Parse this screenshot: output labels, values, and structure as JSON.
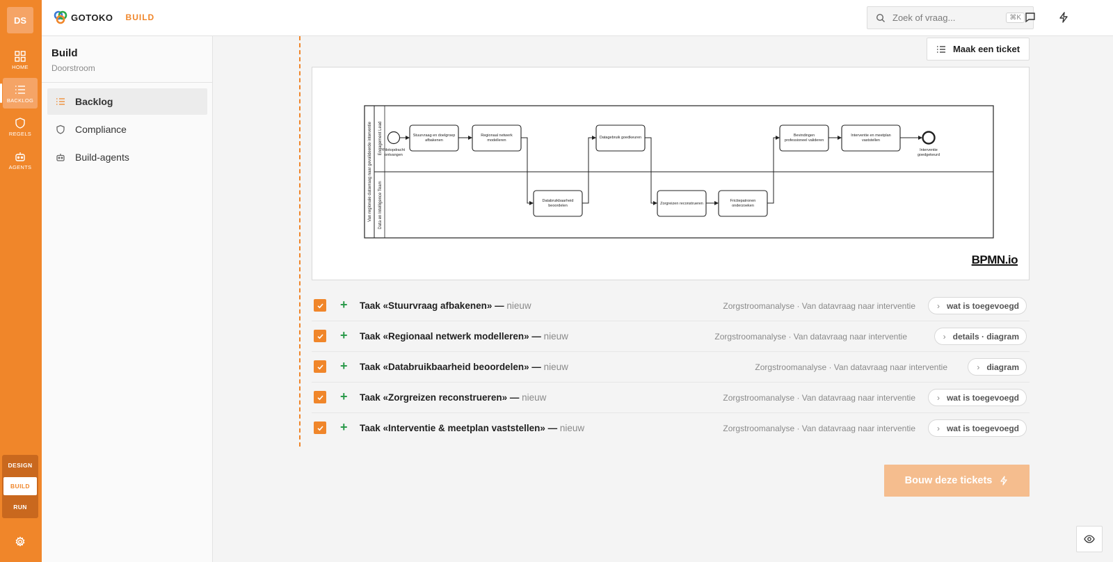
{
  "rail": {
    "avatar": "DS",
    "items": [
      {
        "label": "HOME",
        "icon": "grid-icon"
      },
      {
        "label": "BACKLOG",
        "icon": "list-icon"
      },
      {
        "label": "REGELS",
        "icon": "shield-icon"
      },
      {
        "label": "AGENTS",
        "icon": "robot-icon"
      }
    ],
    "modes": [
      "DESIGN",
      "BUILD",
      "RUN"
    ],
    "accent": "#f0862a"
  },
  "topbar": {
    "logo_text": "GOTOKO",
    "badge": "BUILD",
    "search_placeholder": "Zoek of vraag...",
    "search_shortcut": "⌘K"
  },
  "subnav": {
    "title": "Build",
    "subtitle": "Doorstroom",
    "items": [
      {
        "label": "Backlog",
        "icon": "list-icon",
        "active": true
      },
      {
        "label": "Compliance",
        "icon": "shield-icon",
        "active": false
      },
      {
        "label": "Build-agents",
        "icon": "robot-icon",
        "active": false
      }
    ]
  },
  "main": {
    "ticket_button": "Maak een ticket",
    "diagram": {
      "pool_label": "Van regionale datavraag naar gevalideerde interventie",
      "lanes": [
        "Engagement Lead",
        "Data en Intelligence Team"
      ],
      "start_event": "Pilotopdracht ontvangen",
      "end_event": "Interventie goedgekeurd",
      "tasks": {
        "t1": [
          "Stuurvraag en doelgroep",
          "afbakenen"
        ],
        "t2": [
          "Regionaal netwerk",
          "modelleren"
        ],
        "t3": [
          "Databruikbaarheid",
          "beoordelen"
        ],
        "t4": [
          "Datagebruik goedkeuren"
        ],
        "t5": [
          "Zorgreizen reconstrueren"
        ],
        "t6": [
          "Frictiepatronen",
          "onderzoeken"
        ],
        "t7": [
          "Bevindingen",
          "professioneel valideren"
        ],
        "t8": [
          "Interventie en meetplan",
          "vaststellen"
        ]
      },
      "brand": "BPMN.io"
    },
    "tickets": [
      {
        "title": "Taak «Stuurvraag afbakenen» —",
        "status": " nieuw",
        "context": "Zorgstroomanalyse · Van datavraag naar interventie",
        "action": "wat is toegevoegd"
      },
      {
        "title": "Taak «Regionaal netwerk modelleren» —",
        "status": " nieuw",
        "context": "Zorgstroomanalyse · Van datavraag naar interventie",
        "action": "details · diagram"
      },
      {
        "title": "Taak «Databruikbaarheid beoordelen» —",
        "status": " nieuw",
        "context": "Zorgstroomanalyse · Van datavraag naar interventie",
        "action": "diagram"
      },
      {
        "title": "Taak «Zorgreizen reconstrueren» —",
        "status": " nieuw",
        "context": "Zorgstroomanalyse · Van datavraag naar interventie",
        "action": "wat is toegevoegd"
      },
      {
        "title": "Taak «Interventie & meetplan vaststellen» —",
        "status": " nieuw",
        "context": "Zorgstroomanalyse · Van datavraag naar interventie",
        "action": "wat is toegevoegd"
      }
    ],
    "build_button": "Bouw deze tickets"
  }
}
